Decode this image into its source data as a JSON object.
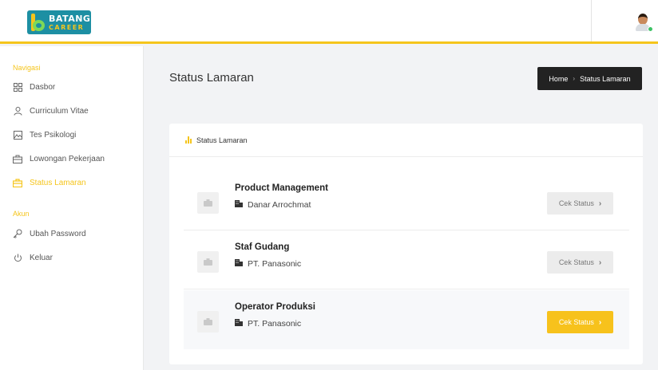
{
  "brand": {
    "line1": "BATANG",
    "line2": "CAREER"
  },
  "sidebar": {
    "section_nav": "Navigasi",
    "nav_items": [
      {
        "label": "Dasbor",
        "icon": "dashboard-icon"
      },
      {
        "label": "Curriculum Vitae",
        "icon": "user-icon"
      },
      {
        "label": "Tes Psikologi",
        "icon": "image-icon"
      },
      {
        "label": "Lowongan Pekerjaan",
        "icon": "briefcase-icon"
      },
      {
        "label": "Status Lamaran",
        "icon": "briefcase-icon",
        "active": true
      }
    ],
    "section_account": "Akun",
    "account_items": [
      {
        "label": "Ubah Password",
        "icon": "key-icon"
      },
      {
        "label": "Keluar",
        "icon": "power-icon"
      }
    ]
  },
  "page": {
    "title": "Status Lamaran",
    "breadcrumb": {
      "home": "Home",
      "separator": "›",
      "current": "Status Lamaran"
    }
  },
  "card": {
    "header": "Status Lamaran",
    "applications": [
      {
        "job": "Product Management",
        "company": "Danar Arrochmat",
        "button": "Cek Status",
        "highlight": false
      },
      {
        "job": "Staf Gudang",
        "company": "PT. Panasonic",
        "button": "Cek Status",
        "highlight": false
      },
      {
        "job": "Operator Produksi",
        "company": "PT. Panasonic",
        "button": "Cek Status",
        "highlight": true
      }
    ]
  },
  "colors": {
    "accent": "#f5c51c",
    "brand": "#1d8fa3",
    "dark": "#222222"
  }
}
